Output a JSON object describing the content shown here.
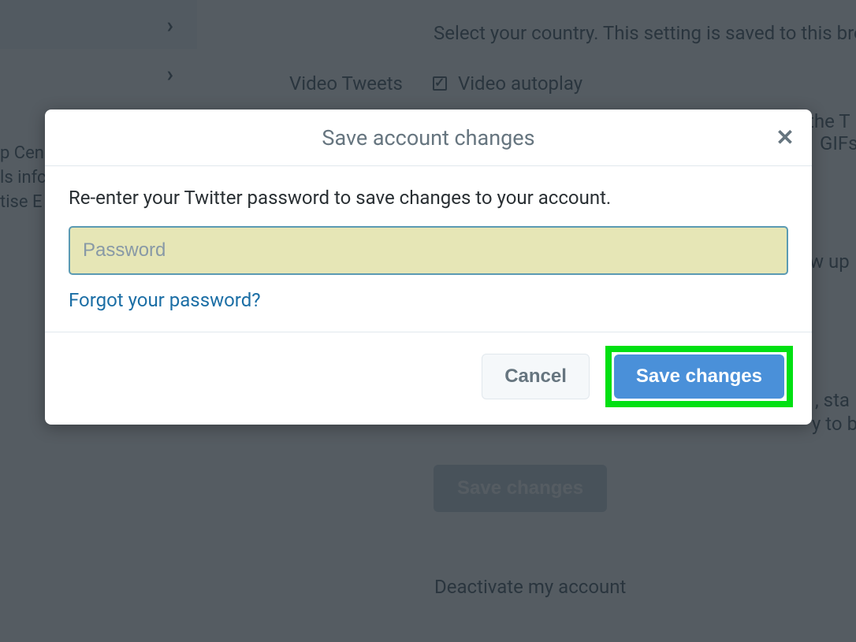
{
  "background": {
    "country_text": "Select your country. This setting is saved to this brows",
    "video_tweets_label": "Video Tweets",
    "video_autoplay_label": "Video autoplay",
    "video_autoplay_checked": true,
    "sidebar_links": {
      "line1": "p Cen",
      "line2": "ls infc",
      "line3": "tise E"
    },
    "truncated_right": {
      "r1": "the T",
      "r2": "GIFs",
      "r3": "w up",
      "r4": ", sta",
      "r5": "y to b"
    },
    "bg_save_label": "Save changes",
    "deactivate_label": "Deactivate my account"
  },
  "modal": {
    "title": "Save account changes",
    "instruction": "Re-enter your Twitter password to save changes to your account.",
    "password_placeholder": "Password",
    "forgot_label": "Forgot your password?",
    "cancel_label": "Cancel",
    "save_label": "Save changes"
  }
}
